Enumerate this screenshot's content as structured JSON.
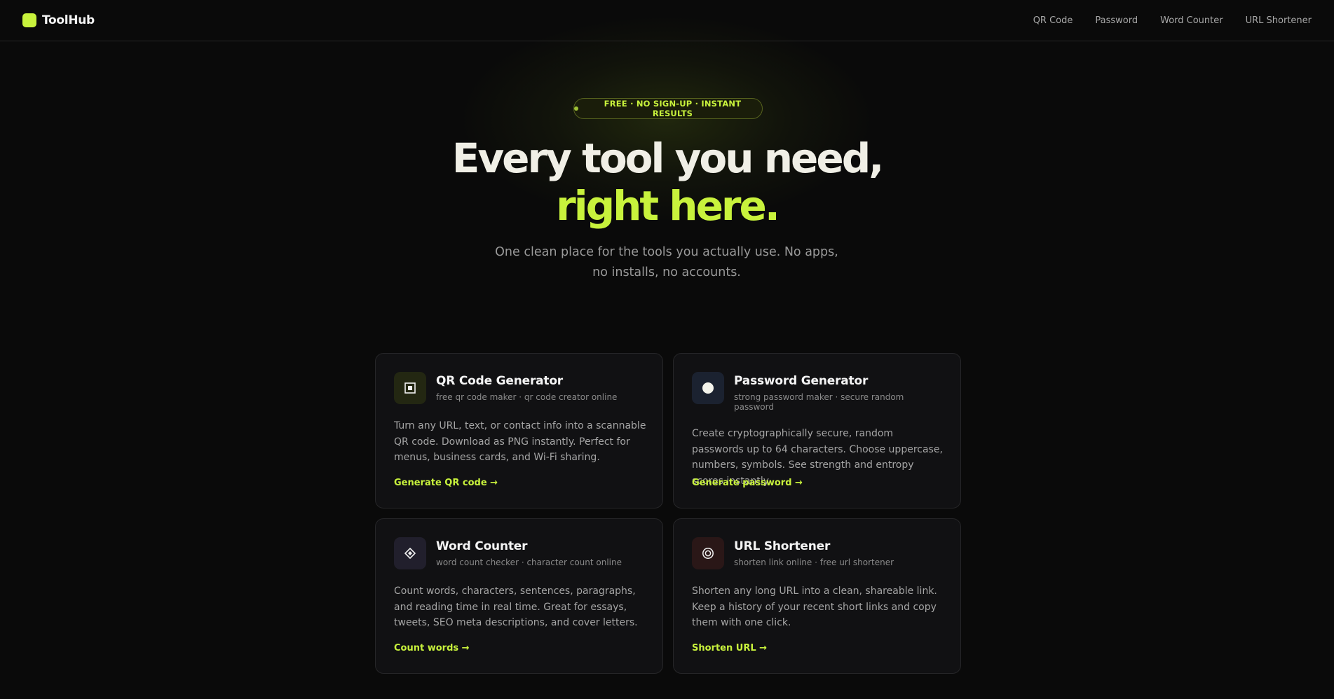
{
  "nav": {
    "brand": "ToolHub",
    "links": [
      "QR Code",
      "Password",
      "Word Counter",
      "URL Shortener"
    ]
  },
  "hero": {
    "badge": "FREE · NO SIGN-UP · INSTANT RESULTS",
    "headline_line1": "Every tool you need,",
    "headline_line2": "right here.",
    "subtitle": "One clean place for the tools you actually use. No apps, no installs, no accounts."
  },
  "cards": [
    {
      "title": "QR Code Generator",
      "tags": "free qr code maker · qr code creator online",
      "description": "Turn any URL, text, or contact info into a scannable QR code. Download as PNG instantly. Perfect for menus, business cards, and Wi-Fi sharing.",
      "link": "Generate QR code →",
      "icon": "qr-square-icon"
    },
    {
      "title": "Password Generator",
      "tags": "strong password maker · secure random password",
      "description": "Create cryptographically secure, random passwords up to 64 characters. Choose uppercase, numbers, symbols. See strength and entropy scores instantly.",
      "link": "Generate password →",
      "icon": "circle-dot-icon"
    },
    {
      "title": "Word Counter",
      "tags": "word count checker · character count online",
      "description": "Count words, characters, sentences, paragraphs, and reading time in real time. Great for essays, tweets, SEO meta descriptions, and cover letters.",
      "link": "Count words →",
      "icon": "diamond-icon"
    },
    {
      "title": "URL Shortener",
      "tags": "shorten link online · free url shortener",
      "description": "Shorten any long URL into a clean, shareable link. Keep a history of your recent short links and copy them with one click.",
      "link": "Shorten URL →",
      "icon": "target-ring-icon"
    }
  ],
  "colors": {
    "accent": "#c8f23c",
    "background": "#0a0a0a",
    "card": "#111113"
  }
}
